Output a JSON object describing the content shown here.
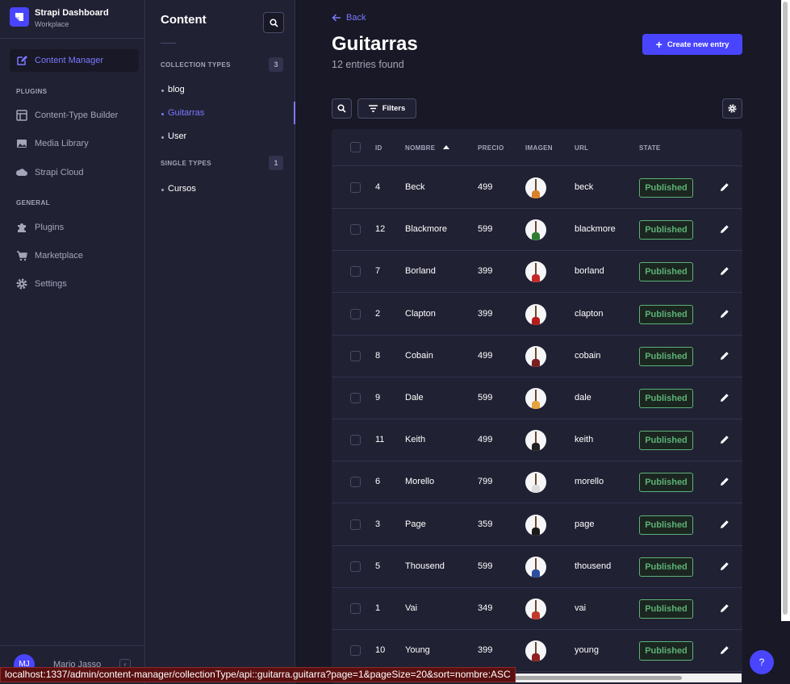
{
  "brand": {
    "title": "Strapi Dashboard",
    "subtitle": "Workplace"
  },
  "mainnav": {
    "content_manager": "Content Manager",
    "plugins_section": "PLUGINS",
    "plugins": [
      "Content-Type Builder",
      "Media Library",
      "Strapi Cloud"
    ],
    "general_section": "GENERAL",
    "general": [
      "Plugins",
      "Marketplace",
      "Settings"
    ],
    "user_initials": "MJ",
    "user_name": "Mario Jasso",
    "collapse_icon": "chevron-left-icon"
  },
  "subnav": {
    "title": "Content",
    "collection_section": "COLLECTION TYPES",
    "collection_count": "3",
    "collection_items": [
      "blog",
      "Guitarras",
      "User"
    ],
    "active_item": "Guitarras",
    "single_section": "SINGLE TYPES",
    "single_count": "1",
    "single_items": [
      "Cursos"
    ]
  },
  "main": {
    "back_label": "Back",
    "title": "Guitarras",
    "subtitle": "12 entries found",
    "create_label": "Create new entry",
    "filters_label": "Filters"
  },
  "table": {
    "headers": {
      "id": "ID",
      "nombre": "NOMBRE",
      "precio": "PRECIO",
      "imagen": "IMAGEN",
      "url": "URL",
      "state": "STATE"
    },
    "sort_indicator": "ascending",
    "rows": [
      {
        "id": "4",
        "nombre": "Beck",
        "precio": "499",
        "url": "beck",
        "state": "Published",
        "guitar_color": "#d9822b"
      },
      {
        "id": "12",
        "nombre": "Blackmore",
        "precio": "599",
        "url": "blackmore",
        "state": "Published",
        "guitar_color": "#2f7d32"
      },
      {
        "id": "7",
        "nombre": "Borland",
        "precio": "399",
        "url": "borland",
        "state": "Published",
        "guitar_color": "#c62828"
      },
      {
        "id": "2",
        "nombre": "Clapton",
        "precio": "399",
        "url": "clapton",
        "state": "Published",
        "guitar_color": "#b71c1c"
      },
      {
        "id": "8",
        "nombre": "Cobain",
        "precio": "499",
        "url": "cobain",
        "state": "Published",
        "guitar_color": "#7a1f1f"
      },
      {
        "id": "9",
        "nombre": "Dale",
        "precio": "599",
        "url": "dale",
        "state": "Published",
        "guitar_color": "#e6a23c"
      },
      {
        "id": "11",
        "nombre": "Keith",
        "precio": "499",
        "url": "keith",
        "state": "Published",
        "guitar_color": "#222222"
      },
      {
        "id": "6",
        "nombre": "Morello",
        "precio": "799",
        "url": "morello",
        "state": "Published",
        "guitar_color": "#dddddd"
      },
      {
        "id": "3",
        "nombre": "Page",
        "precio": "359",
        "url": "page",
        "state": "Published",
        "guitar_color": "#1a1a1a"
      },
      {
        "id": "5",
        "nombre": "Thousend",
        "precio": "599",
        "url": "thousend",
        "state": "Published",
        "guitar_color": "#2b4f9e"
      },
      {
        "id": "1",
        "nombre": "Vai",
        "precio": "349",
        "url": "vai",
        "state": "Published",
        "guitar_color": "#c0392b"
      },
      {
        "id": "10",
        "nombre": "Young",
        "precio": "399",
        "url": "young",
        "state": "Published",
        "guitar_color": "#8e2020"
      }
    ]
  },
  "status_bar_url": "localhost:1337/admin/content-manager/collectionType/api::guitarra.guitarra?page=1&pageSize=20&sort=nombre:ASC",
  "help_label": "?",
  "colors": {
    "accent": "#4945ff",
    "accent_text": "#7b79ff",
    "published": "#5cb176",
    "background": "#181826",
    "panel": "#212134"
  }
}
